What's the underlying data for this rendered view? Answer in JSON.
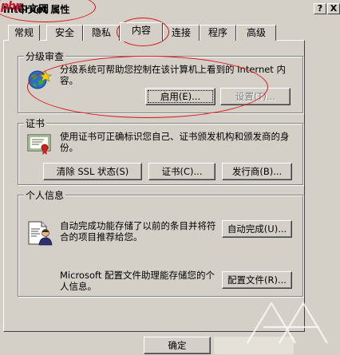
{
  "window": {
    "title": "Internet 属性",
    "help_glyph": "?",
    "close_glyph": "X",
    "watermark": {
      "logo": "php",
      "text": "中文网"
    }
  },
  "tabs": [
    {
      "label": "常规",
      "active": false
    },
    {
      "label": "安全",
      "active": false
    },
    {
      "label": "隐私",
      "active": false
    },
    {
      "label": "内容",
      "active": true
    },
    {
      "label": "连接",
      "active": false
    },
    {
      "label": "程序",
      "active": false
    },
    {
      "label": "高级",
      "active": false
    }
  ],
  "content_advisor": {
    "title": "分级审查",
    "description": "分级系统可帮助您控制在该计算机上看到的 Internet 内容。",
    "enable_button": "启用(E)...",
    "settings_button": "设置(T)...",
    "settings_disabled": true,
    "icon": "globe-star-icon"
  },
  "certificates": {
    "title": "证书",
    "description": "使用证书可正确标识您自己、证书颁发机构和颁发商的身份。",
    "clear_ssl_button": "清除 SSL 状态(S)",
    "certificates_button": "证书(C)...",
    "publishers_button": "发行商(B)...",
    "icon": "certificate-icon"
  },
  "personal_info": {
    "title": "个人信息",
    "autocomplete_description": "自动完成功能存储了以前的条目并将符合的项目推荐给您。",
    "autocomplete_button": "自动完成(U)...",
    "profile_description": "Microsoft 配置文件助理能存储您的个人信息。",
    "profile_button": "配置文件(R)...",
    "icon": "profile-document-icon"
  },
  "footer": {
    "ok_button": "确定"
  },
  "colors": {
    "dialog_face": "#d4d0c8",
    "annotation_red": "#dd1111"
  }
}
